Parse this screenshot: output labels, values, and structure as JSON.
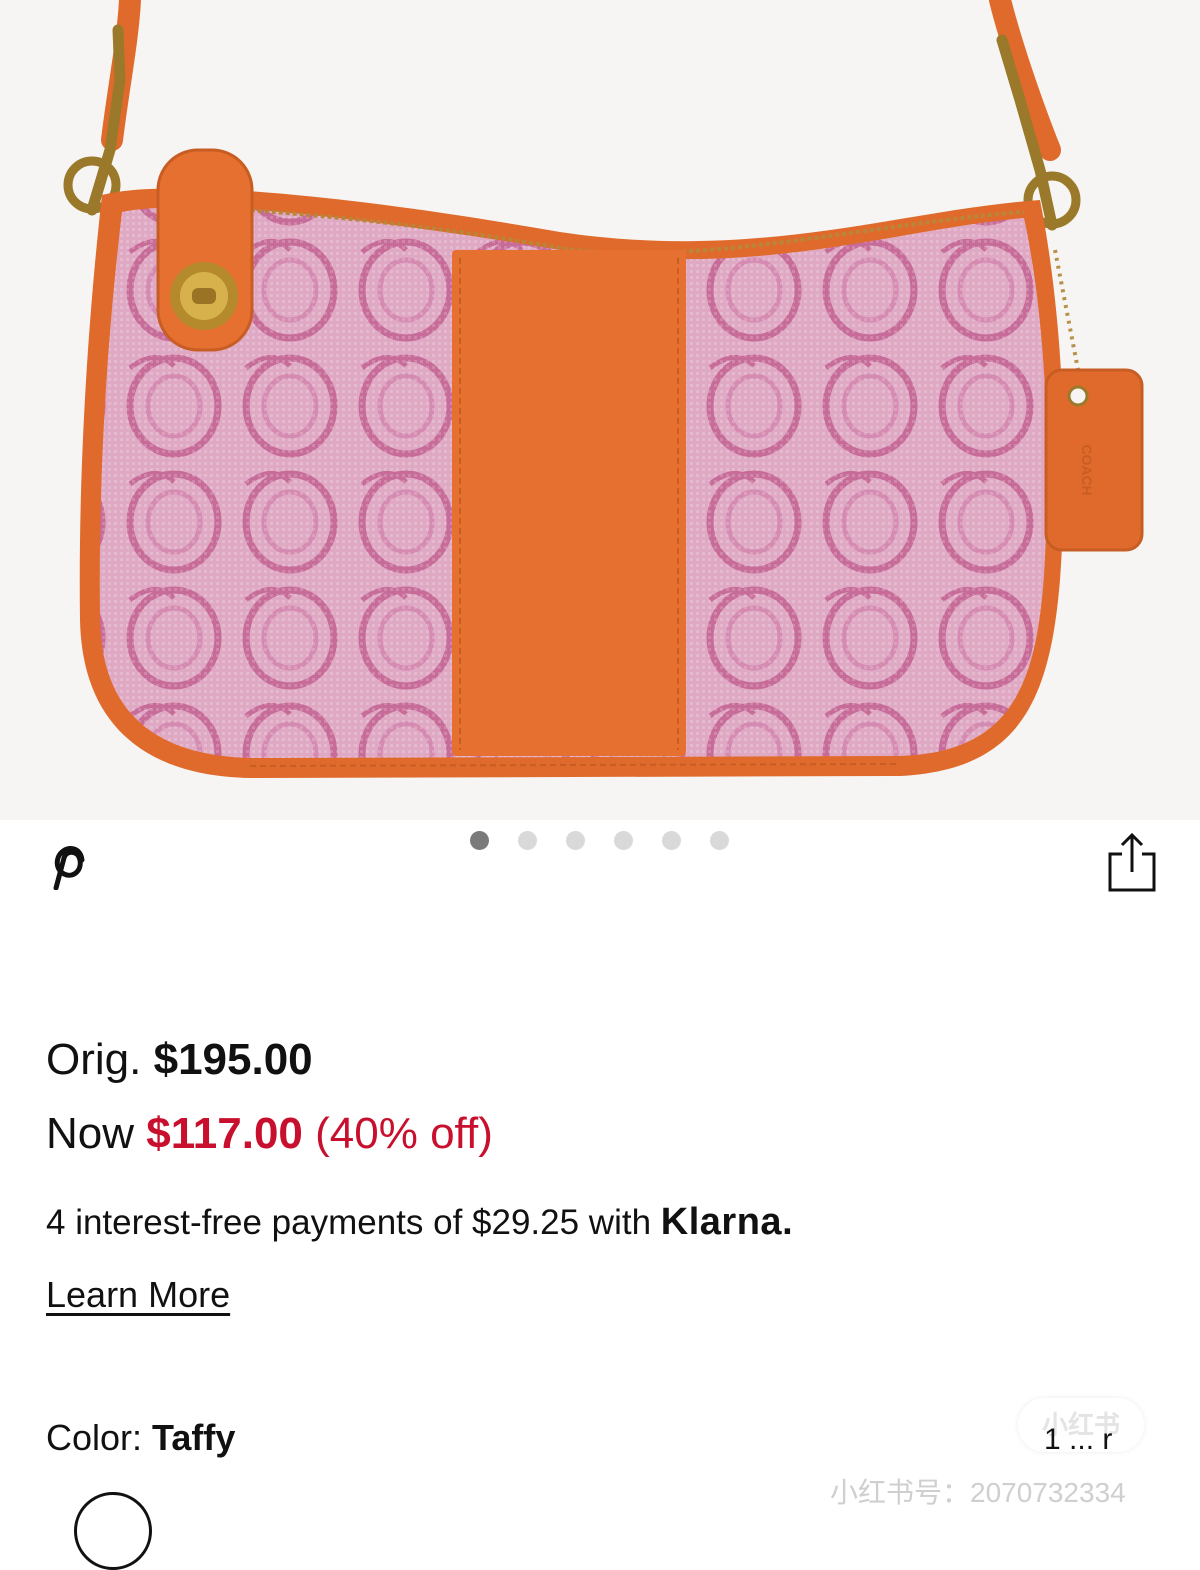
{
  "product": {
    "image_alt": "Coach signature jacquard shoulder bag in Taffy",
    "hangtag_text": "COACH",
    "carousel": {
      "total": 6,
      "active_index": 0
    }
  },
  "price": {
    "orig_label": "Orig.",
    "orig_value": "$195.00",
    "now_label": "Now",
    "now_value": "$117.00",
    "discount": "(40% off)",
    "sale_color": "#c8102e"
  },
  "klarna": {
    "text": "4 interest-free payments of $29.25 with",
    "brand": "Klarna."
  },
  "learn_more_label": "Learn More",
  "color": {
    "label": "Color:",
    "value": "Taffy"
  },
  "icons": {
    "pin": "pinterest-icon",
    "share": "share-icon"
  },
  "overlay": {
    "watermark_badge": "小红书",
    "partial_text": "1 ... r",
    "watermark_id": "小红书号：2070732334"
  }
}
